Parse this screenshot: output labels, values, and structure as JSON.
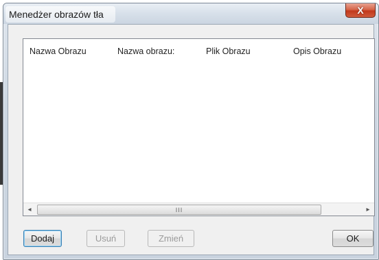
{
  "window": {
    "title": "Menedżer obrazów tła",
    "close_label": "X"
  },
  "listview": {
    "columns": [
      "Nazwa Obrazu",
      "Nazwa obrazu:",
      "Plik Obrazu",
      "Opis Obrazu"
    ],
    "rows": [],
    "scrollbar": {
      "left_arrow": "◂",
      "right_arrow": "▸",
      "thumb_grip": "III"
    }
  },
  "buttons": {
    "add": "Dodaj",
    "remove": "Usuń",
    "change": "Zmień",
    "ok": "OK"
  }
}
